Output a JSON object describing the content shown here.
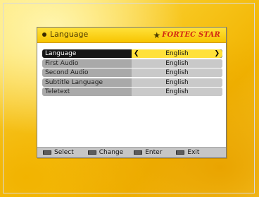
{
  "header": {
    "title": "Language",
    "brand": "FORTEC STAR"
  },
  "settings": [
    {
      "label": "Language",
      "value": "English",
      "selected": true
    },
    {
      "label": "First Audio",
      "value": "English"
    },
    {
      "label": "Second Audio",
      "value": "English"
    },
    {
      "label": "Subtitle Language",
      "value": "English"
    },
    {
      "label": "Teletext",
      "value": "English"
    }
  ],
  "footer": {
    "select": "Select",
    "change": "Change",
    "enter": "Enter",
    "exit": "Exit"
  },
  "colors": {
    "accent": "#f7c400",
    "selected_bg": "#161616",
    "brand_red": "#d42a12"
  }
}
